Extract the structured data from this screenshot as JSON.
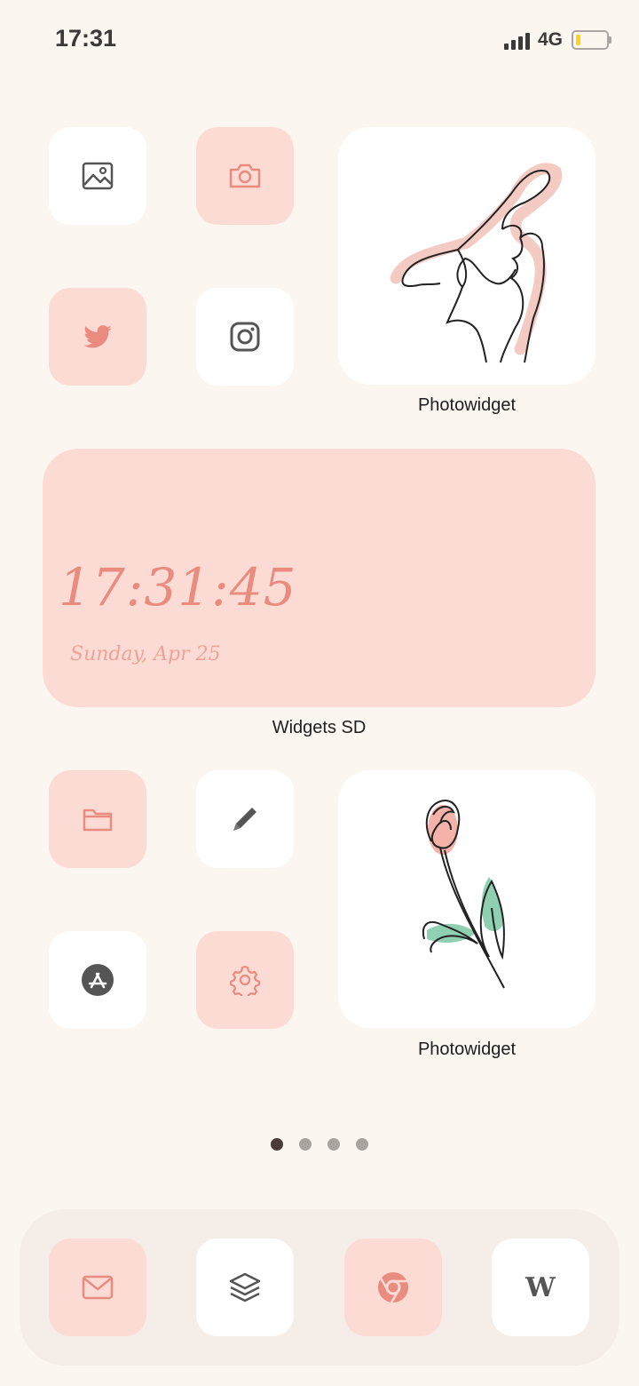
{
  "status_bar": {
    "time": "17:31",
    "network": "4G",
    "battery_level": 0.15
  },
  "home": {
    "apps": [
      {
        "name": "photos",
        "icon": "image-icon",
        "style": "white"
      },
      {
        "name": "camera",
        "icon": "camera-icon",
        "style": "pink"
      },
      {
        "name": "twitter",
        "icon": "twitter-bird-icon",
        "style": "pink"
      },
      {
        "name": "instagram",
        "icon": "instagram-icon",
        "style": "white"
      },
      {
        "name": "files",
        "icon": "folder-icon",
        "style": "pink"
      },
      {
        "name": "notes",
        "icon": "pencil-icon",
        "style": "white"
      },
      {
        "name": "app-store",
        "icon": "app-store-icon",
        "style": "white"
      },
      {
        "name": "settings",
        "icon": "gear-icon",
        "style": "pink"
      }
    ],
    "widgets": {
      "photo_top_label": "Photowidget",
      "clock_label": "Widgets SD",
      "clock_time": "17:31:45",
      "clock_date": "Sunday, Apr 25",
      "photo_bottom_label": "Photowidget"
    },
    "page_indicator": {
      "total": 4,
      "current": 1
    }
  },
  "dock": {
    "apps": [
      {
        "name": "mail",
        "icon": "mail-icon",
        "style": "pink"
      },
      {
        "name": "layers",
        "icon": "layers-icon",
        "style": "white"
      },
      {
        "name": "chrome",
        "icon": "chrome-icon",
        "style": "pink"
      },
      {
        "name": "wikipedia",
        "icon": "wikipedia-icon",
        "style": "white",
        "glyph": "W"
      }
    ]
  },
  "colors": {
    "background": "#fcf6f0",
    "pink_tile": "#fddbd5",
    "accent": "#ea8b80",
    "icon_dark": "#555555",
    "leaf_green": "#8fd0b2"
  }
}
